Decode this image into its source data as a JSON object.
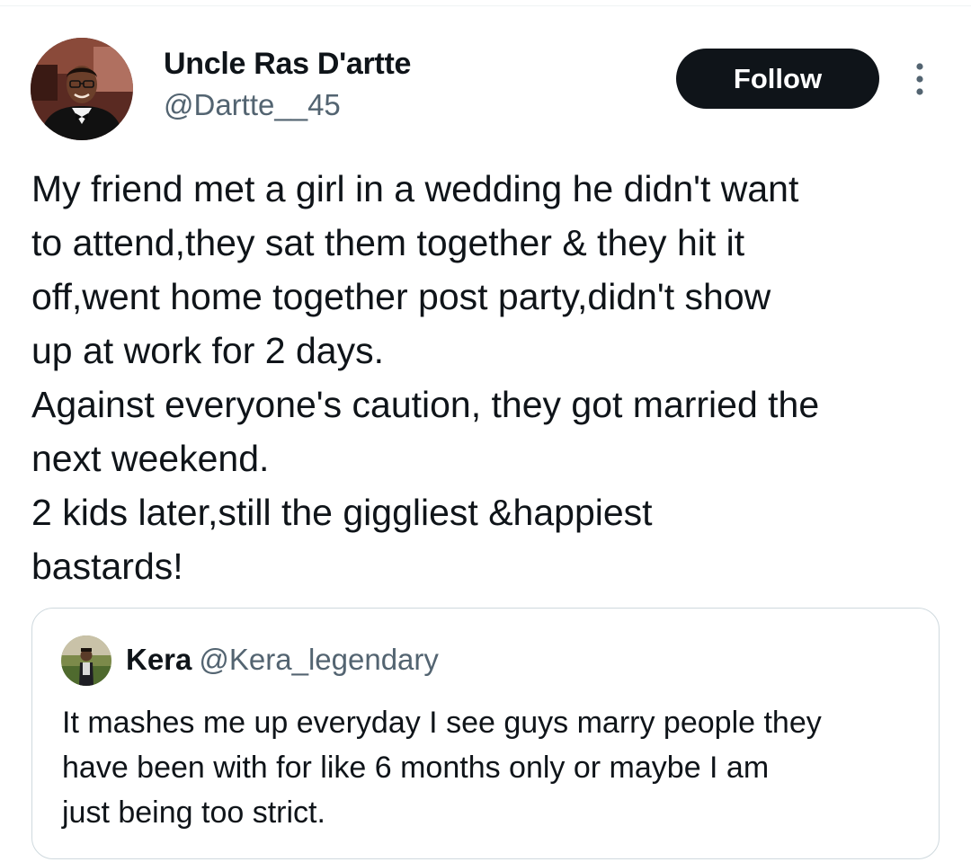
{
  "tweet": {
    "author": {
      "name": "Uncle Ras D'artte",
      "handle": "@Dartte__45",
      "avatar_icon": "profile-photo"
    },
    "follow_label": "Follow",
    "more_icon": "more-vertical-icon",
    "text_lines": [
      "My friend met a girl in a wedding he didn't want",
      "to attend,they sat them together & they hit it",
      "off,went home together post party,didn't show",
      "up at work for 2 days.",
      "Against everyone's caution, they got married the",
      "next weekend.",
      "2 kids later,still the giggliest &happiest",
      "bastards!"
    ]
  },
  "quoted_tweet": {
    "name": "Kera",
    "handle": "@Kera_legendary",
    "avatar_icon": "profile-photo",
    "text_lines": [
      "It mashes me up everyday I see guys marry people they",
      "have been with for like 6 months only or maybe I am",
      "just being too strict."
    ]
  },
  "colors": {
    "primary_text": "#0f1419",
    "secondary_text": "#536471",
    "follow_bg": "#0f1419",
    "border": "#cfd9de"
  }
}
